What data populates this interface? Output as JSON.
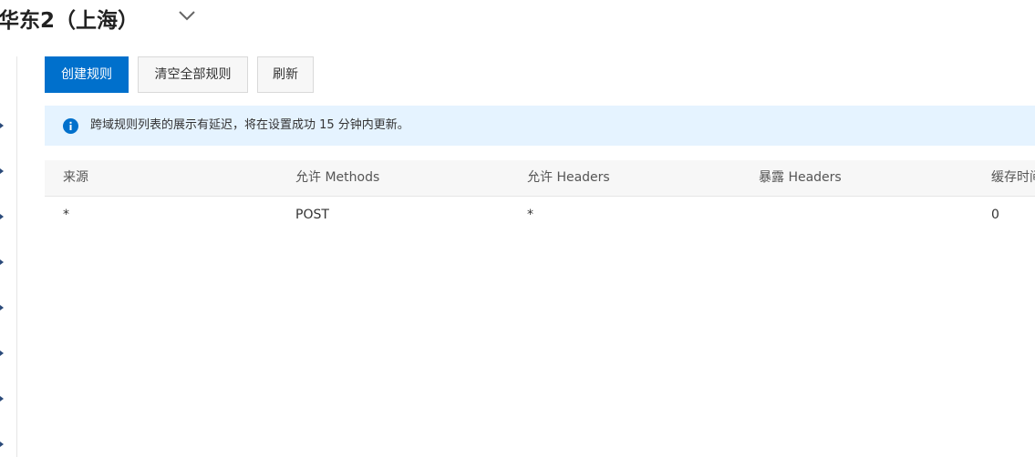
{
  "header": {
    "region_title": "华东2（上海）",
    "dropdown_icon": "chevron-down-icon"
  },
  "sidebar": {
    "marker_icon": "caret-right-icon",
    "marker_color": "#2b4a7a"
  },
  "toolbar": {
    "create_label": "创建规则",
    "clear_label": "清空全部规则",
    "refresh_label": "刷新"
  },
  "notice": {
    "icon": "info-icon",
    "text": "跨域规则列表的展示有延迟，将在设置成功 15 分钟内更新。"
  },
  "table": {
    "headers": [
      "来源",
      "允许 Methods",
      "允许 Headers",
      "暴露 Headers",
      "缓存时间"
    ],
    "rows": [
      [
        "*",
        "POST",
        "*",
        "",
        "0"
      ]
    ]
  },
  "colors": {
    "primary": "#0070cc",
    "notice_bg": "#e5f3ff",
    "info_icon": "#0070cc",
    "table_header_bg": "#f7f7f7"
  }
}
